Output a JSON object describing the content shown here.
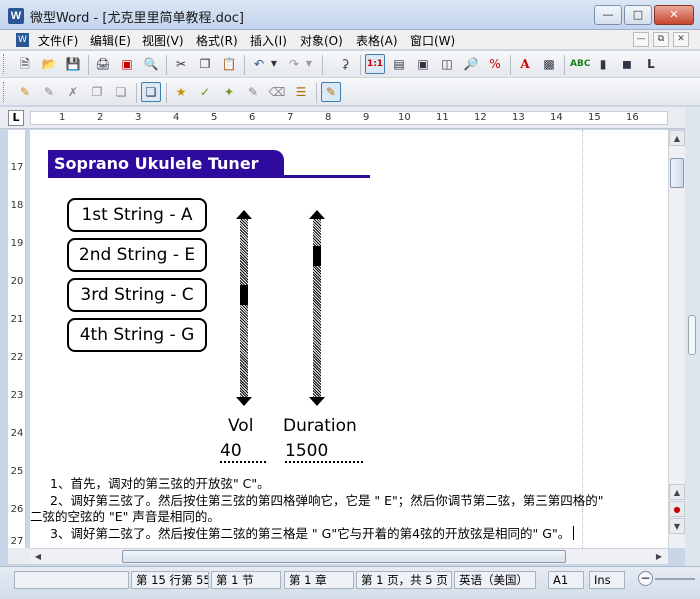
{
  "window": {
    "title": "微型Word - [尤克里里简单教程.doc]",
    "app_icon": "W"
  },
  "menu": {
    "items": [
      "文件(F)",
      "编辑(E)",
      "视图(V)",
      "格式(R)",
      "插入(I)",
      "对象(O)",
      "表格(A)",
      "窗口(W)"
    ]
  },
  "ruler": {
    "corner": "L",
    "h_numbers": [
      "1",
      "2",
      "3",
      "4",
      "5",
      "6",
      "7",
      "8",
      "9",
      "10",
      "11",
      "12",
      "13",
      "14",
      "15",
      "16"
    ],
    "v_numbers": [
      "17",
      "18",
      "19",
      "20",
      "21",
      "22",
      "23",
      "24",
      "25",
      "26",
      "27"
    ]
  },
  "tuner": {
    "title": "Soprano Ukulele Tuner",
    "strings": [
      "1st String - A",
      "2nd String - E",
      "3rd String - C",
      "4th String - G"
    ],
    "vol_label": "Vol",
    "vol_value": "40",
    "duration_label": "Duration",
    "duration_value": "1500",
    "vol_level": 0.42,
    "duration_level": 0.17
  },
  "body": {
    "line1": "1、首先，调对的第三弦的开放弦\" C\"。",
    "line2": "2、调好第三弦了。然后按住第三弦的第四格弹响它，它是 \" E\"；然后你调节第二弦，第三第四格的\"",
    "line3": "二弦的空弦的 \"E\" 声音是相同的。",
    "line4": "3、调好第二弦了。然后按住第二弦的第三格是 \" G\"它与开着的第4弦的开放弦是相同的\" G\"。"
  },
  "status": {
    "position": "第 15 行第 55",
    "section": "第 1 节",
    "chapter": "第 1 章",
    "page": "第 1 页，共 5 页",
    "language": "英语（美国）",
    "cell": "A1",
    "mode": "Ins"
  },
  "colors": {
    "banner": "#2e0a9e"
  }
}
